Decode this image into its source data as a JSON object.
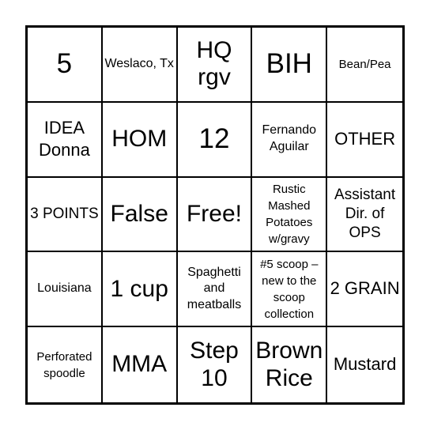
{
  "board": {
    "cells": [
      {
        "text": "5"
      },
      {
        "text": "Weslaco, Tx"
      },
      {
        "text": "HQ rgv"
      },
      {
        "text": "BIH"
      },
      {
        "text": "Bean/Pea"
      },
      {
        "text": "IDEA Donna"
      },
      {
        "text": "HOM"
      },
      {
        "text": "12"
      },
      {
        "text": "Fernando Aguilar"
      },
      {
        "text": "OTHER"
      },
      {
        "text": "3 POINTS"
      },
      {
        "text": "False"
      },
      {
        "text": "Free!"
      },
      {
        "text": "Rustic Mashed Potatoes w/gravy"
      },
      {
        "text": "Assistant Dir. of OPS"
      },
      {
        "text": "Louisiana"
      },
      {
        "text": "1 cup"
      },
      {
        "text": "Spaghetti and meatballs"
      },
      {
        "text": "#5 scoop – new to the scoop collection"
      },
      {
        "text": "2 GRAIN"
      },
      {
        "text": "Perforated spoodle"
      },
      {
        "text": "MMA"
      },
      {
        "text": "Step 10"
      },
      {
        "text": "Brown Rice"
      },
      {
        "text": "Mustard"
      }
    ]
  }
}
